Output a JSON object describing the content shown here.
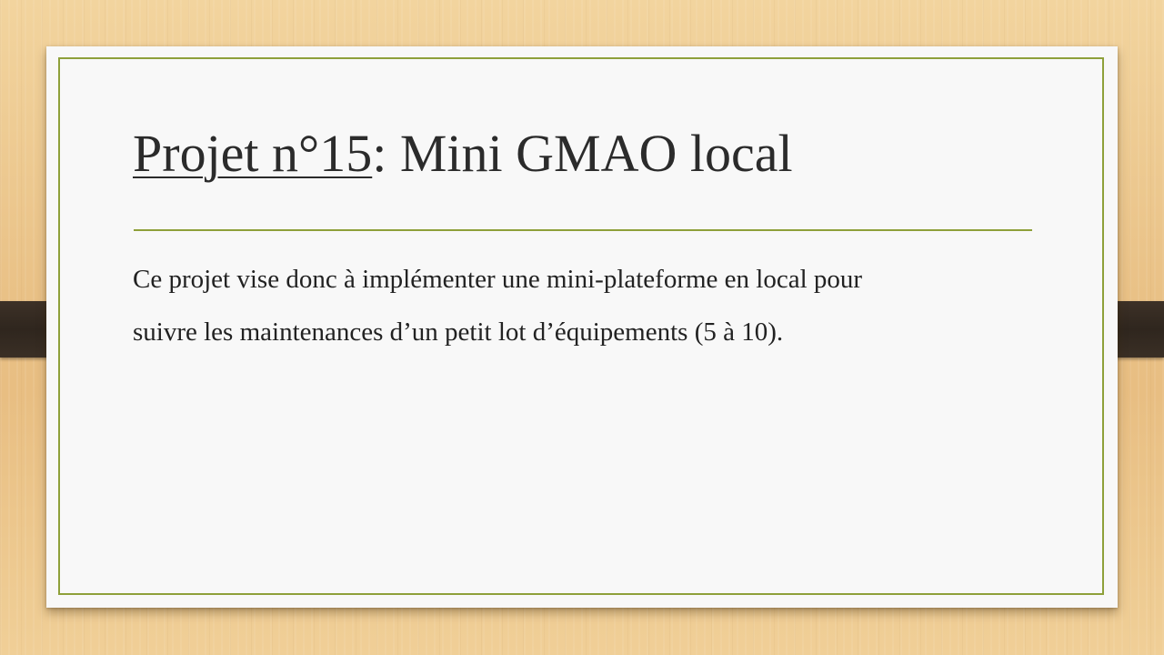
{
  "slide": {
    "title_link": "Projet n°15",
    "title_rest": ": Mini GMAO local",
    "body_line_1": "Ce projet vise donc à implémenter une mini-plateforme en local pour",
    "body_line_2": "suivre les maintenances d’un petit lot d’équipements (5 à 10)."
  },
  "colors": {
    "frame_accent": "#8ea03a",
    "card_background": "#f8f8f8",
    "strap": "#342a21",
    "text": "#2b2b2b"
  }
}
